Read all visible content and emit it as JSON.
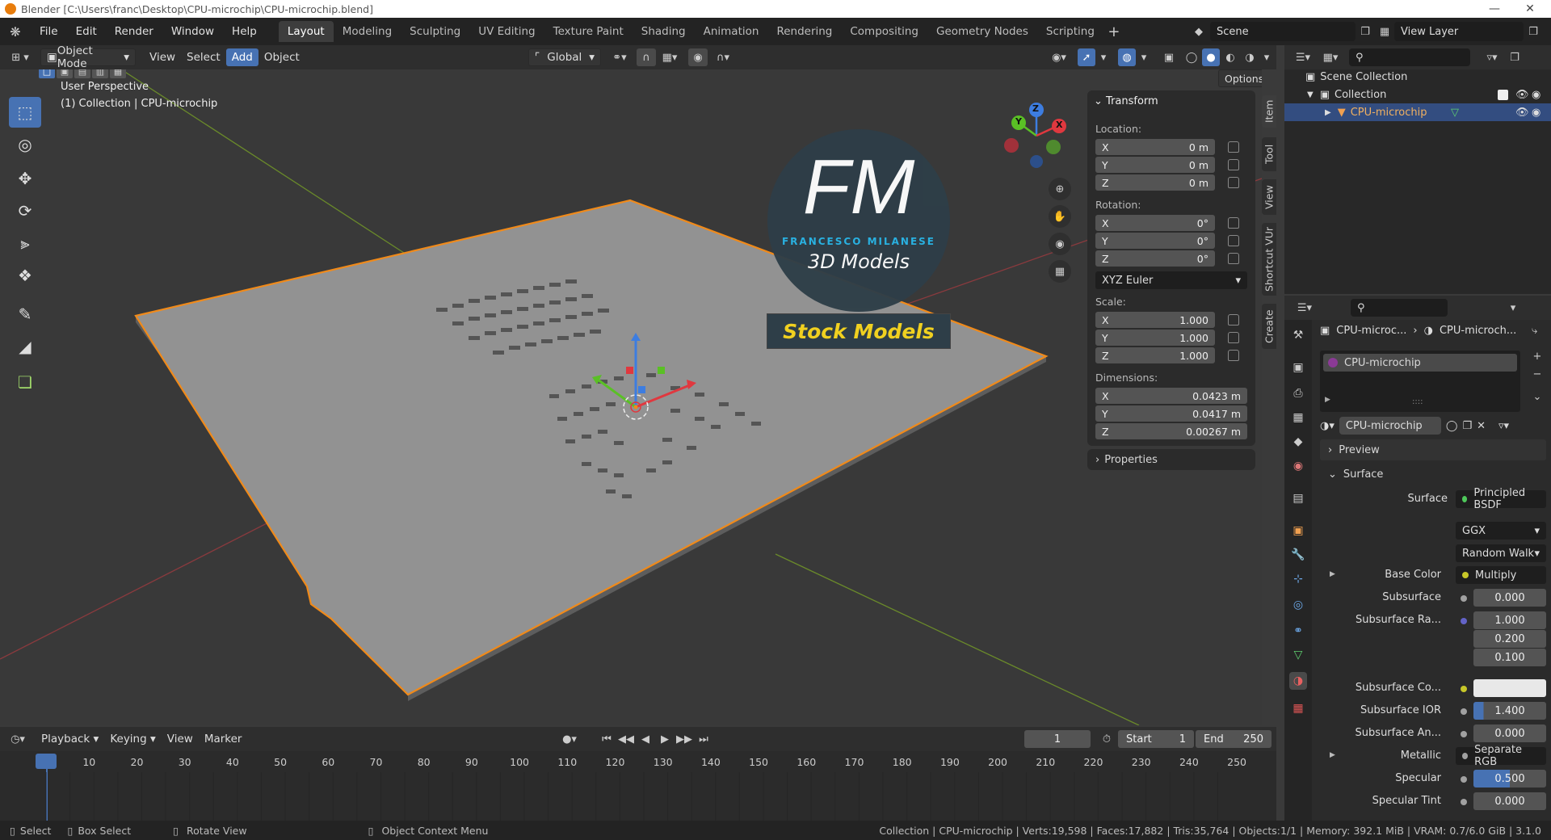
{
  "window": {
    "title": "Blender [C:\\Users\\franc\\Desktop\\CPU-microchip\\CPU-microchip.blend]"
  },
  "menu": [
    "File",
    "Edit",
    "Render",
    "Window",
    "Help"
  ],
  "workspaces": [
    "Layout",
    "Modeling",
    "Sculpting",
    "UV Editing",
    "Texture Paint",
    "Shading",
    "Animation",
    "Rendering",
    "Compositing",
    "Geometry Nodes",
    "Scripting"
  ],
  "active_workspace": "Layout",
  "scene": "Scene",
  "view_layer": "View Layer",
  "viewport_header": {
    "mode": "Object Mode",
    "menus": [
      "View",
      "Select",
      "Add",
      "Object"
    ],
    "active_menu": "Add",
    "orientation": "Global",
    "options": "Options"
  },
  "viewport": {
    "perspective": "User Perspective",
    "collection_info": "(1) Collection | CPU-microchip"
  },
  "watermark": {
    "initials": "FM",
    "name": "FRANCESCO MILANESE",
    "subtitle": "3D Models",
    "banner": "Stock Models"
  },
  "gizmo": {
    "x": "X",
    "y": "Y",
    "z": "Z"
  },
  "npanel": {
    "title": "Transform",
    "location_label": "Location:",
    "location": [
      {
        "axis": "X",
        "value": "0 m"
      },
      {
        "axis": "Y",
        "value": "0 m"
      },
      {
        "axis": "Z",
        "value": "0 m"
      }
    ],
    "rotation_label": "Rotation:",
    "rotation": [
      {
        "axis": "X",
        "value": "0°"
      },
      {
        "axis": "Y",
        "value": "0°"
      },
      {
        "axis": "Z",
        "value": "0°"
      }
    ],
    "rotation_mode": "XYZ Euler",
    "scale_label": "Scale:",
    "scale": [
      {
        "axis": "X",
        "value": "1.000"
      },
      {
        "axis": "Y",
        "value": "1.000"
      },
      {
        "axis": "Z",
        "value": "1.000"
      }
    ],
    "dimensions_label": "Dimensions:",
    "dimensions": [
      {
        "axis": "X",
        "value": "0.0423 m"
      },
      {
        "axis": "Y",
        "value": "0.0417 m"
      },
      {
        "axis": "Z",
        "value": "0.00267 m"
      }
    ],
    "properties": "Properties",
    "tabs": [
      "Item",
      "Tool",
      "View",
      "Shortcut VUr",
      "Create"
    ]
  },
  "outliner": {
    "scene_collection": "Scene Collection",
    "collection": "Collection",
    "object": "CPU-microchip"
  },
  "properties": {
    "breadcrumb_object": "CPU-microc...",
    "breadcrumb_material": "CPU-microch...",
    "slot": "CPU-microchip",
    "material_name": "CPU-microchip",
    "preview": "Preview",
    "surface_section": "Surface",
    "surface_label": "Surface",
    "surface_value": "Principled BSDF",
    "distribution": "GGX",
    "subsurface_method": "Random Walk",
    "rows": [
      {
        "label": "Base Color",
        "value": "Multiply"
      },
      {
        "label": "Subsurface",
        "value": "0.000"
      },
      {
        "label": "Subsurface Ra...",
        "value": "1.000"
      },
      {
        "label": "",
        "value": "0.200"
      },
      {
        "label": "",
        "value": "0.100"
      },
      {
        "label": "Subsurface Co...",
        "value": ""
      },
      {
        "label": "Subsurface IOR",
        "value": "1.400"
      },
      {
        "label": "Subsurface An...",
        "value": "0.000"
      },
      {
        "label": "Metallic",
        "value": "Separate RGB"
      },
      {
        "label": "Specular",
        "value": "0.500"
      },
      {
        "label": "Specular Tint",
        "value": "0.000"
      }
    ]
  },
  "timeline": {
    "menus": [
      "Playback",
      "Keying",
      "View",
      "Marker"
    ],
    "current_frame": "1",
    "start_label": "Start",
    "start": "1",
    "end_label": "End",
    "end": "250",
    "ticks": [
      "1",
      "10",
      "20",
      "30",
      "40",
      "50",
      "60",
      "70",
      "80",
      "90",
      "100",
      "110",
      "120",
      "130",
      "140",
      "150",
      "160",
      "170",
      "180",
      "190",
      "200",
      "210",
      "220",
      "230",
      "240",
      "250"
    ]
  },
  "status": {
    "select": "Select",
    "box_select": "Box Select",
    "rotate_view": "Rotate View",
    "context_menu": "Object Context Menu",
    "stats": "Collection | CPU-microchip | Verts:19,598 | Faces:17,882 | Tris:35,764 | Objects:1/1 | Memory: 392.1 MiB | VRAM: 0.7/6.0 GiB | 3.1.0"
  }
}
